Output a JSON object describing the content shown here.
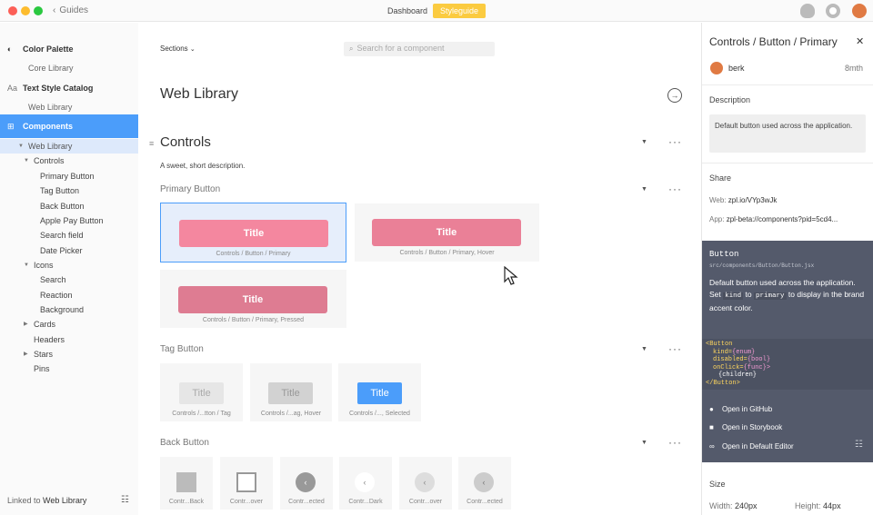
{
  "titlebar": {
    "back_label": "Guides",
    "tabs": [
      "Dashboard",
      "Styleguide"
    ]
  },
  "sidebar": {
    "items": [
      {
        "label": "Color Palette",
        "icon": "palette-icon"
      },
      {
        "label": "Core Library"
      },
      {
        "label": "Text Style Catalog",
        "icon": "text-icon",
        "icon_text": "Aa"
      },
      {
        "label": "Web Library"
      },
      {
        "label": "Components",
        "icon": "grid-icon"
      },
      {
        "label": "Web Library"
      },
      {
        "label": "Controls"
      },
      {
        "label": "Primary Button"
      },
      {
        "label": "Tag Button"
      },
      {
        "label": "Back Button"
      },
      {
        "label": "Apple Pay Button"
      },
      {
        "label": "Search field"
      },
      {
        "label": "Date Picker"
      },
      {
        "label": "Icons"
      },
      {
        "label": "Search"
      },
      {
        "label": "Reaction"
      },
      {
        "label": "Background"
      },
      {
        "label": "Cards"
      },
      {
        "label": "Headers"
      },
      {
        "label": "Stars"
      },
      {
        "label": "Pins"
      }
    ],
    "footer_prefix": "Linked to",
    "footer_link": "Web Library"
  },
  "main": {
    "sections_label": "Sections",
    "search_placeholder": "Search for a component",
    "library_title": "Web Library",
    "controls_title": "Controls",
    "controls_desc": "A sweet, short description.",
    "primary_group": "Primary Button",
    "primary_cards": [
      {
        "title": "Title",
        "label": "Controls / Button / Primary",
        "color": "#f4879f"
      },
      {
        "title": "Title",
        "label": "Controls / Button / Primary, Hover",
        "color": "#ea8097"
      },
      {
        "title": "Title",
        "label": "Controls / Button / Primary, Pressed",
        "color": "#de7c92"
      }
    ],
    "tag_group": "Tag Button",
    "tag_cards": [
      {
        "title": "Title",
        "label": "Controls /...tton / Tag"
      },
      {
        "title": "Title",
        "label": "Controls /...ag, Hover"
      },
      {
        "title": "Title",
        "label": "Controls /..., Selected"
      }
    ],
    "back_group": "Back Button",
    "back_cards": [
      {
        "label": "Contr...Back"
      },
      {
        "label": "Contr...over"
      },
      {
        "label": "Contr...ected"
      },
      {
        "label": "Contr...Dark"
      },
      {
        "label": "Contr...over"
      },
      {
        "label": "Contr...ected"
      }
    ]
  },
  "panel": {
    "title": "Controls / Button / Primary",
    "user": "berk",
    "time": "8mth",
    "description_heading": "Description",
    "description": "Default button used across the application.",
    "share_heading": "Share",
    "web_label": "Web:",
    "web_value": "zpl.io/VYp3wJk",
    "app_label": "App:",
    "app_value": "zpl-beta://components?pid=5cd4...",
    "component_name": "Button",
    "component_path": "src/components/Button/Button.jsx",
    "component_desc_1": "Default button used across the application.",
    "component_desc_2a": "Set",
    "component_desc_kind": "kind",
    "component_desc_2b": "to",
    "component_desc_primary": "primary",
    "component_desc_2c": "to display in the brand accent color.",
    "code": {
      "open": "<Button",
      "kind": "kind=",
      "kind_val": "{enum}",
      "disabled": "disabled=",
      "disabled_val": "{bool}",
      "onclick": "onClick=",
      "onclick_val": "{func}>",
      "children": "{children}",
      "close": "</Button>"
    },
    "links": [
      "Open in GitHub",
      "Open in Storybook",
      "Open in Default Editor"
    ],
    "size_heading": "Size",
    "width_label": "Width:",
    "width_value": "240px",
    "height_label": "Height:",
    "height_value": "44px"
  }
}
